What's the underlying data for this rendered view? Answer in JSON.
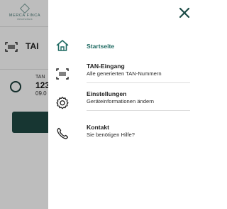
{
  "background_app": {
    "logo_text": "MERCA FINCA",
    "logo_sub": "PRIVATE BANK",
    "section_title": "TAI",
    "tan_label": "TAN",
    "tan_number": "123",
    "tan_date": "09.0"
  },
  "menu": {
    "items": [
      {
        "title": "Startseite",
        "subtitle": "",
        "icon": "home-icon",
        "active": true
      },
      {
        "title": "TAN-Eingang",
        "subtitle": "Alle generierten TAN-Nummern",
        "icon": "barcode-scan-icon",
        "active": false
      },
      {
        "title": "Einstellungen",
        "subtitle": "Geräteinformationen ändern",
        "icon": "gear-icon",
        "active": false
      },
      {
        "title": "Kontakt",
        "subtitle": "Sie benötigen Hilfe?",
        "icon": "phone-icon",
        "active": false
      }
    ]
  },
  "colors": {
    "accent": "#1e6a62",
    "button": "#204a44",
    "overlay": "rgba(0,0,0,0.26)"
  }
}
